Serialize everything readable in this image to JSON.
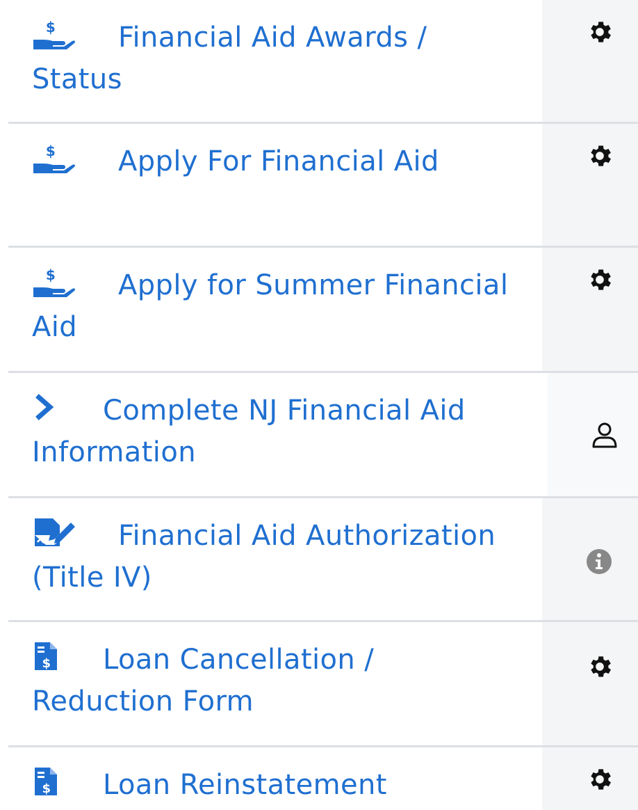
{
  "menu": {
    "items": [
      {
        "label": "Financial Aid Awards / Status",
        "icon": "hand-holding-dollar-icon",
        "action_icon": "gear-icon"
      },
      {
        "label": "Apply For Financial Aid",
        "icon": "hand-holding-dollar-icon",
        "action_icon": "gear-icon"
      },
      {
        "label": "Apply for Summer Financial Aid",
        "icon": "hand-holding-dollar-icon",
        "action_icon": "gear-icon"
      },
      {
        "label": "Complete NJ Financial Aid Information",
        "icon": "chevron-right-icon",
        "action_icon": "user-icon"
      },
      {
        "label": "Financial Aid Authorization (Title IV)",
        "icon": "file-signature-icon",
        "action_icon": "info-circle-icon"
      },
      {
        "label": "Loan Cancellation / Reduction Form",
        "icon": "file-invoice-dollar-icon",
        "action_icon": "gear-icon"
      },
      {
        "label": "Loan Reinstatement",
        "icon": "file-invoice-dollar-icon",
        "action_icon": "gear-icon"
      }
    ]
  },
  "colors": {
    "link": "#1f6fd0",
    "gear": "#111111",
    "info": "#888888",
    "divider": "#dcdfe3",
    "side_panel": "#f4f5f6"
  }
}
